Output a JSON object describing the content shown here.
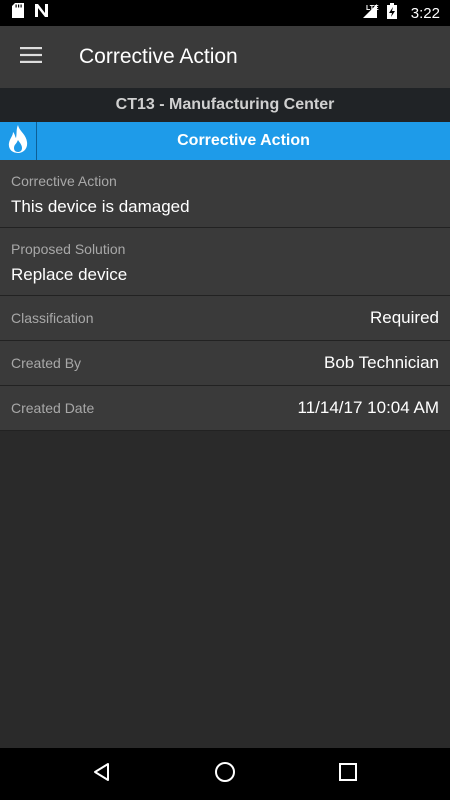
{
  "status_bar": {
    "time": "3:22",
    "network": "LTE",
    "icons": [
      "sd-card-icon",
      "n-notification-icon",
      "signal-icon",
      "battery-charging-icon"
    ]
  },
  "app_bar": {
    "title": "Corrective Action",
    "menu_icon": "hamburger-menu-icon"
  },
  "location": {
    "title": "CT13 - Manufacturing Center"
  },
  "section": {
    "title": "Corrective Action",
    "icon": "flame-icon",
    "accent_color": "#1e9be9"
  },
  "details": {
    "corrective_action": {
      "label": "Corrective Action",
      "value": "This device is damaged"
    },
    "proposed_solution": {
      "label": "Proposed Solution",
      "value": "Replace device"
    },
    "classification": {
      "label": "Classification",
      "value": "Required"
    },
    "created_by": {
      "label": "Created By",
      "value": "Bob Technician"
    },
    "created_date": {
      "label": "Created Date",
      "value": "11/14/17 10:04 AM"
    }
  },
  "nav_bar": {
    "icons": [
      "back-icon",
      "home-icon",
      "recents-icon"
    ]
  }
}
